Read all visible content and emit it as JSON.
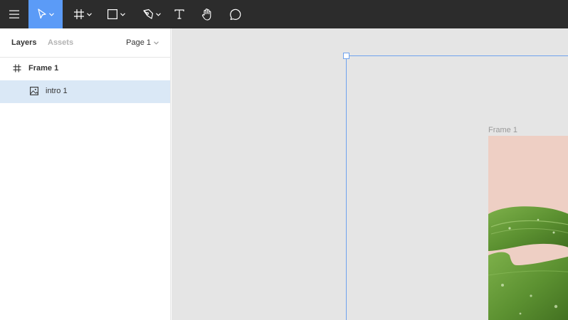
{
  "toolbar": {
    "tools": [
      {
        "name": "menu-icon"
      },
      {
        "name": "move-tool-icon",
        "active": true
      },
      {
        "name": "frame-tool-icon"
      },
      {
        "name": "rectangle-tool-icon"
      },
      {
        "name": "pen-tool-icon"
      },
      {
        "name": "text-tool-icon"
      },
      {
        "name": "hand-tool-icon"
      },
      {
        "name": "comment-tool-icon"
      }
    ],
    "accent": "#5b9bf7",
    "background": "#2c2c2c"
  },
  "left_panel": {
    "tabs": [
      "Layers",
      "Assets"
    ],
    "page_select": "Page 1",
    "layers": [
      {
        "label": "Frame 1",
        "icon": "frame-icon",
        "selected": false
      },
      {
        "label": "intro 1",
        "icon": "image-icon",
        "selected": true
      }
    ],
    "selection_color": "#dae8f6"
  },
  "canvas": {
    "background": "#e5e5e5",
    "frame_label": "Frame 1",
    "frame_fill": "#eecfc4",
    "selection_color": "#6ea2ee"
  }
}
